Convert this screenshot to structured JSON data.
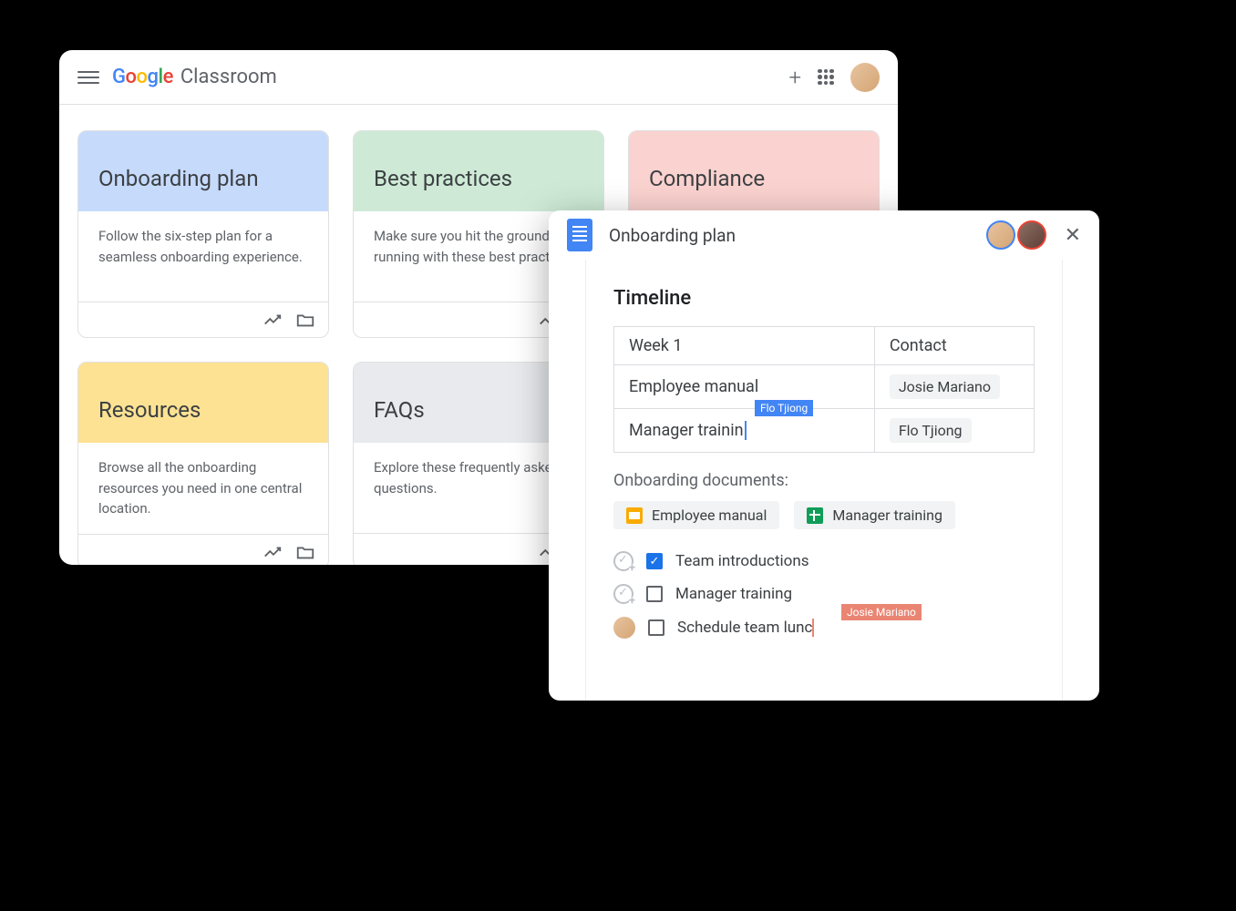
{
  "classroom": {
    "app_name": "Classroom",
    "cards": [
      {
        "title": "Onboarding plan",
        "desc": "Follow the six-step plan for a seamless onboarding experience.",
        "color": "card-blue"
      },
      {
        "title": "Best practices",
        "desc": "Make sure you hit the ground running with these best practices.",
        "color": "card-green"
      },
      {
        "title": "Compliance",
        "desc": "",
        "color": "card-pink"
      },
      {
        "title": "Resources",
        "desc": "Browse all the onboarding resources you need in one central location.",
        "color": "card-yellow"
      },
      {
        "title": "FAQs",
        "desc": "Explore these frequently asked questions.",
        "color": "card-gray"
      }
    ]
  },
  "docs": {
    "title": "Onboarding plan",
    "section_heading": "Timeline",
    "table": {
      "headers": [
        "Week 1",
        "Contact"
      ],
      "rows": [
        {
          "task": "Employee manual",
          "contact": "Josie Mariano"
        },
        {
          "task": "Manager trainin",
          "contact": "Flo Tjiong"
        }
      ],
      "cursor_tag": "Flo Tjiong"
    },
    "onboarding_label": "Onboarding documents:",
    "doc_links": [
      {
        "type": "slides",
        "label": "Employee manual"
      },
      {
        "type": "sheets",
        "label": "Manager training"
      }
    ],
    "checklist": [
      {
        "label": "Team introductions",
        "checked": true,
        "assigner": "icon"
      },
      {
        "label": "Manager training",
        "checked": false,
        "assigner": "icon"
      },
      {
        "label": "Schedule team lunc",
        "checked": false,
        "assigner": "avatar",
        "cursor_tag": "Josie Mariano"
      }
    ]
  }
}
